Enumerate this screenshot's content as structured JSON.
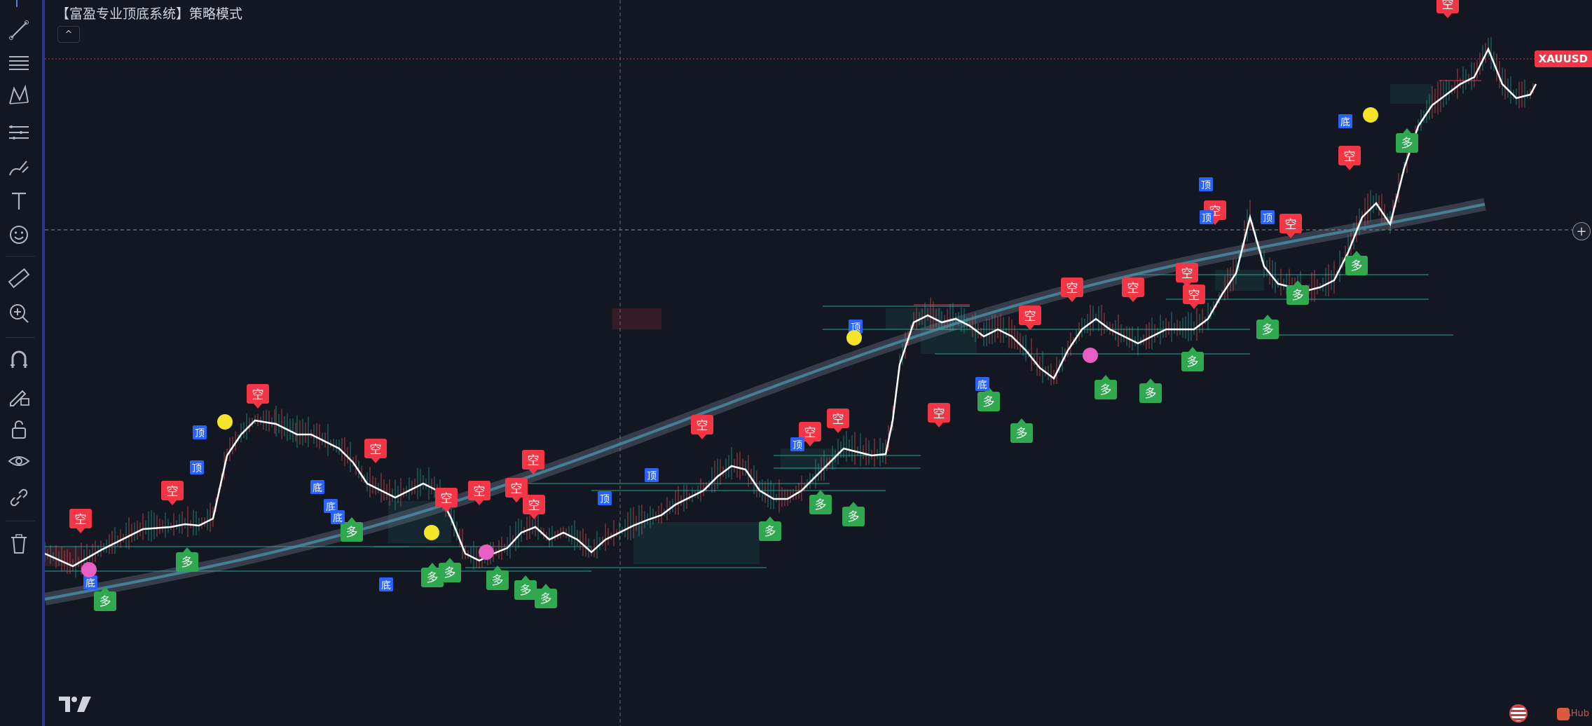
{
  "indicator": {
    "title": "【富盈专业顶底系统】策略模式",
    "collapse_glyph": "^"
  },
  "symbol": {
    "name": "XAUUSD"
  },
  "labels": {
    "short": "空",
    "long": "多",
    "top": "顶",
    "bottom": "底"
  },
  "watermark": {
    "brand": "EAHub"
  },
  "toolbar": {
    "tools": [
      "trend-line-icon",
      "horizontal-lines-icon",
      "pattern-icon",
      "fib-icon",
      "brush-icon",
      "text-icon",
      "emoji-icon",
      "ruler-icon",
      "zoom-in-icon",
      "magnet-icon",
      "lock-drawing-icon",
      "lock-icon",
      "eye-icon",
      "link-icon",
      "trash-icon"
    ]
  },
  "colors": {
    "background": "#131722",
    "short_signal": "#f23645",
    "long_signal": "#2fa84f",
    "top_bottom_badge": "#2962ff",
    "price_line": "#ffffff",
    "band": "#4a90a8",
    "marker_yellow": "#f5e52a",
    "marker_pink": "#e85fc4"
  }
}
